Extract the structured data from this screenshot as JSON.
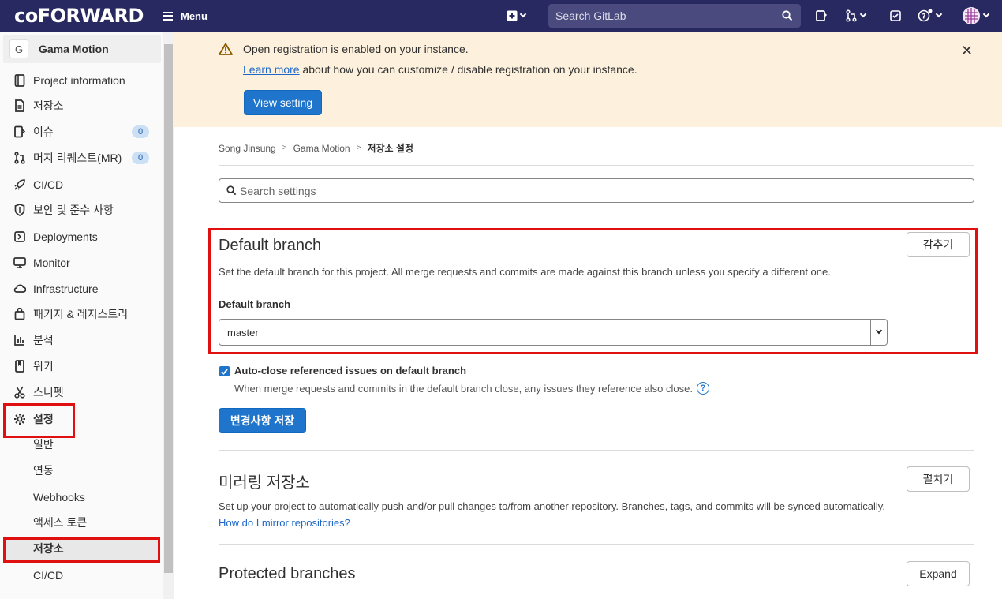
{
  "topbar": {
    "logo": "coFORWARD",
    "menu_label": "Menu",
    "search_placeholder": "Search GitLab",
    "icons": [
      "plus-square-icon",
      "issues-icon",
      "merge-request-icon",
      "todo-icon",
      "help-icon",
      "user-avatar-icon"
    ]
  },
  "sidebar": {
    "project_initial": "G",
    "project_name": "Gama Motion",
    "items": [
      {
        "label": "Project information",
        "icon": "project-icon"
      },
      {
        "label": "저장소",
        "icon": "document-icon"
      },
      {
        "label": "이슈",
        "icon": "issues-icon",
        "badge": "0"
      },
      {
        "label": "머지 리퀘스트(MR)",
        "icon": "merge-request-icon",
        "badge": "0"
      },
      {
        "label": "CI/CD",
        "icon": "rocket-icon"
      },
      {
        "label": "보안 및 준수 사항",
        "icon": "shield-icon"
      },
      {
        "label": "Deployments",
        "icon": "deployments-icon"
      },
      {
        "label": "Monitor",
        "icon": "monitor-icon"
      },
      {
        "label": "Infrastructure",
        "icon": "cloud-icon"
      },
      {
        "label": "패키지 & 레지스트리",
        "icon": "package-icon"
      },
      {
        "label": "분석",
        "icon": "chart-icon"
      },
      {
        "label": "위키",
        "icon": "book-icon"
      },
      {
        "label": "스니펫",
        "icon": "scissors-icon"
      },
      {
        "label": "설정",
        "icon": "gear-icon"
      }
    ],
    "settings_sub": [
      "일반",
      "연동",
      "Webhooks",
      "액세스 토큰",
      "저장소",
      "CI/CD"
    ]
  },
  "banner": {
    "title": "Open registration is enabled on your instance.",
    "link": "Learn more",
    "text": " about how you can customize / disable registration on your instance.",
    "button": "View setting"
  },
  "breadcrumb": [
    "Song Jinsung",
    "Gama Motion",
    "저장소 설정"
  ],
  "search_settings": {
    "placeholder": "Search settings"
  },
  "default_branch": {
    "title": "Default branch",
    "toggle": "감추기",
    "desc": "Set the default branch for this project. All merge requests and commits are made against this branch unless you specify a different one.",
    "label": "Default branch",
    "value": "master",
    "checkbox_label": "Auto-close referenced issues on default branch",
    "checkbox_checked": true,
    "checkbox_help": "When merge requests and commits in the default branch close, any issues they reference also close.",
    "save": "변경사항 저장"
  },
  "mirroring": {
    "title": "미러링 저장소",
    "toggle": "펼치기",
    "desc": "Set up your project to automatically push and/or pull changes to/from another repository. Branches, tags, and commits will be synced automatically.",
    "link": "How do I mirror repositories?"
  },
  "protected": {
    "title": "Protected branches",
    "toggle": "Expand"
  },
  "colors": {
    "topbar": "#292961",
    "primary": "#1f75cb",
    "highlight": "#e01010"
  }
}
